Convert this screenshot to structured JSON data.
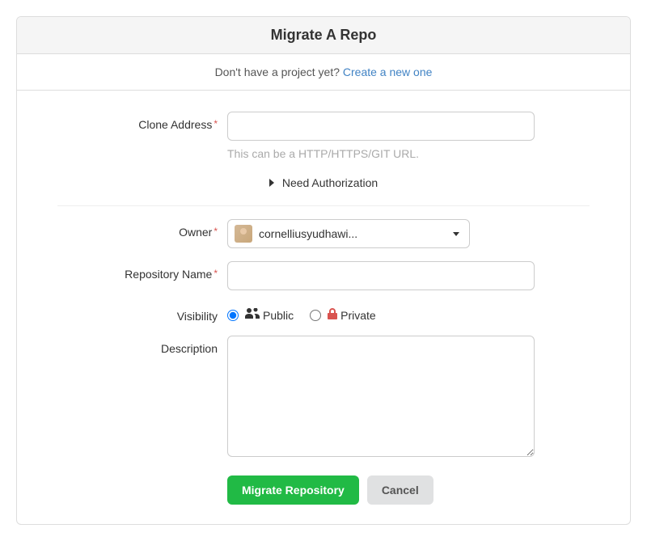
{
  "header": {
    "title": "Migrate A Repo"
  },
  "info": {
    "text": "Don't have a project yet? ",
    "link": "Create a new one"
  },
  "fields": {
    "clone_address": {
      "label": "Clone Address",
      "value": "",
      "help": "This can be a HTTP/HTTPS/GIT URL."
    },
    "auth_toggle": "Need Authorization",
    "owner": {
      "label": "Owner",
      "selected": "cornelliusyudhawi..."
    },
    "repo_name": {
      "label": "Repository Name",
      "value": ""
    },
    "visibility": {
      "label": "Visibility",
      "public": "Public",
      "private": "Private"
    },
    "description": {
      "label": "Description",
      "value": ""
    }
  },
  "buttons": {
    "submit": "Migrate Repository",
    "cancel": "Cancel"
  }
}
